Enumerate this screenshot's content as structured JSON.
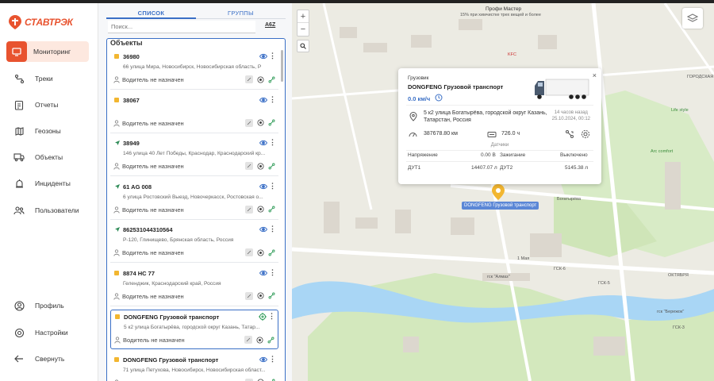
{
  "brand": {
    "name": "СТАВТРЭК",
    "accent": "#e8532f"
  },
  "nav": {
    "items": [
      {
        "label": "Мониторинг",
        "icon": "monitoring-icon",
        "active": true
      },
      {
        "label": "Треки",
        "icon": "tracks-icon"
      },
      {
        "label": "Отчеты",
        "icon": "reports-icon"
      },
      {
        "label": "Геозоны",
        "icon": "geozones-icon"
      },
      {
        "label": "Объекты",
        "icon": "truck-icon"
      },
      {
        "label": "Инциденты",
        "icon": "incidents-icon"
      },
      {
        "label": "Пользователи",
        "icon": "users-icon"
      }
    ],
    "bottom": [
      {
        "label": "Профиль",
        "icon": "profile-icon"
      },
      {
        "label": "Настройки",
        "icon": "settings-icon"
      },
      {
        "label": "Свернуть",
        "icon": "collapse-icon"
      }
    ]
  },
  "panel": {
    "tabs": [
      "СПИСОК",
      "ГРУППЫ"
    ],
    "search_placeholder": "Поиск...",
    "sort_label": "A6Z",
    "objects_title": "Объекты",
    "cards": [
      {
        "name": "36980",
        "address": "66 улица Мира, Новосибирск, Новосибирская область, Р",
        "driver": "Водитель не назначен",
        "marker": "square"
      },
      {
        "name": "38067",
        "address": "",
        "driver": "Водитель не назначен",
        "marker": "square"
      },
      {
        "name": "38949",
        "address": "146 улица 40 Лет Победы, Краснодар, Краснодарский кр...",
        "driver": "Водитель не назначен",
        "marker": "arrow"
      },
      {
        "name": "61 AG 008",
        "address": "6 улица Ростовский Выезд, Новочеркасск, Ростовская о...",
        "driver": "Водитель не назначен",
        "marker": "arrow"
      },
      {
        "name": "862531044310564",
        "address": "Р-120, Глинищево, Брянская область, Россия",
        "driver": "Водитель не назначен",
        "marker": "arrow"
      },
      {
        "name": "8874 НС 77",
        "address": "Геленджик, Краснодарский край, Россия",
        "driver": "Водитель не назначен",
        "marker": "square"
      },
      {
        "name": "DONGFENG Грузовой транспорт",
        "address": "5 к2 улица Богатырёва, городской округ Казань, Татар...",
        "driver": "Водитель не назначен",
        "marker": "square",
        "selected": true
      },
      {
        "name": "DONGFENG Грузовой транспорт",
        "address": "71 улица Петухова, Новосибирск, Новосибирская област...",
        "driver": "Водитель не назначен",
        "marker": "square"
      }
    ]
  },
  "map": {
    "labels": {
      "profi": "Профи Мастер",
      "profi_sub": "15% при химчистке трех вещей и более",
      "kfc": "KFC",
      "lifestyle": "Life style",
      "arc": "Arc comfort",
      "pack": "ГСК-6",
      "almaz": "гск \"Алмаз\"",
      "bereg": "гск \"Бережок\"",
      "may": "1 Мая",
      "bogat": "Богатырёва",
      "gsk5": "ГСК-5",
      "gsk3": "ГСК-3",
      "oktyabr": "ОКТЯБРЯ",
      "gorodskaya": "ГОРОДСКАЯ"
    },
    "vehicle_label": "DONGFENG Грузовой транспорт",
    "popup": {
      "category": "Грузовик",
      "name": "DONGFENG Грузовой транспорт",
      "speed": "0.0 км/ч",
      "address": "5 к2 улица Богатырёва, городской округ Казань, Татарстан, Россия",
      "time_ago": "14 часов назад",
      "time": "25.10.2024, 00:12",
      "mileage": "387678.80 км",
      "engine_hours": "726.0 ч",
      "sensors_title": "Датчики",
      "voltage_label": "Напряжение",
      "voltage_value": "0.00 В",
      "ignition_label": "Зажигание",
      "ignition_value": "Выключено",
      "dut1_label": "ДУТ1",
      "dut1_value": "14407.07 л",
      "dut2_label": "ДУТ2",
      "dut2_value": "5145.38 л"
    }
  }
}
